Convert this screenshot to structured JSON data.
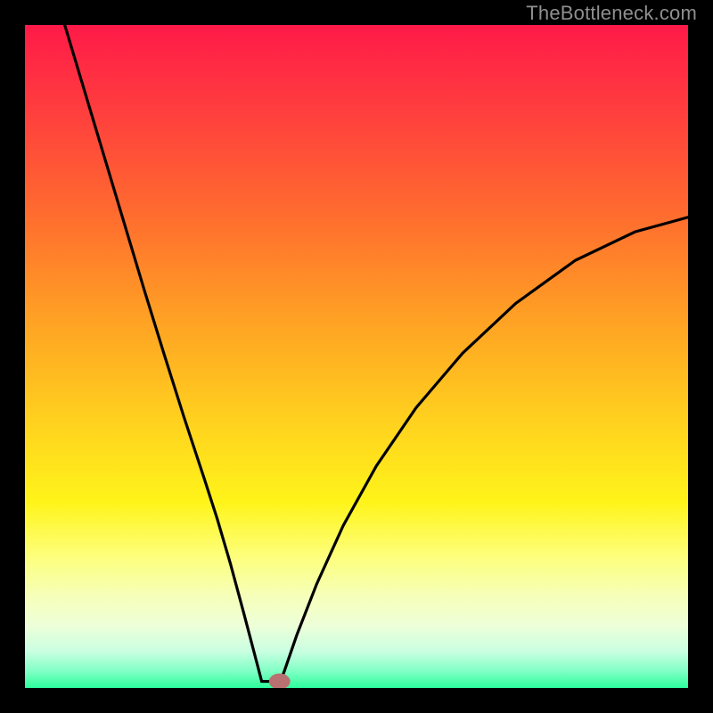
{
  "meta": {
    "watermark": "TheBottleneck.com"
  },
  "chart_data": {
    "type": "line",
    "title": "",
    "xlabel": "",
    "ylabel": "",
    "xlim": [
      0,
      100
    ],
    "ylim": [
      0,
      100
    ],
    "minimum_x": 37,
    "notch_width": 3,
    "curve_top_left_y": 100,
    "curve_top_left_x": 6,
    "curve_right_end_y": 71,
    "marker": {
      "x": 38.4,
      "y": 1.0,
      "rx": 1.6,
      "ry": 1.2,
      "color": "#b87070"
    },
    "gradient_stops": [
      {
        "offset": 0.0,
        "color": "#ff1a48"
      },
      {
        "offset": 0.12,
        "color": "#ff3b3f"
      },
      {
        "offset": 0.28,
        "color": "#ff6a2f"
      },
      {
        "offset": 0.44,
        "color": "#ffa024"
      },
      {
        "offset": 0.6,
        "color": "#ffd21e"
      },
      {
        "offset": 0.72,
        "color": "#fff41a"
      },
      {
        "offset": 0.8,
        "color": "#fdff7a"
      },
      {
        "offset": 0.86,
        "color": "#f6ffb8"
      },
      {
        "offset": 0.905,
        "color": "#eeffd8"
      },
      {
        "offset": 0.945,
        "color": "#c9ffe2"
      },
      {
        "offset": 0.975,
        "color": "#7fffc4"
      },
      {
        "offset": 1.0,
        "color": "#2bff9a"
      }
    ],
    "curve_points": [
      {
        "x": 6.0,
        "y": 100.0
      },
      {
        "x": 9.0,
        "y": 90.0
      },
      {
        "x": 12.0,
        "y": 80.0
      },
      {
        "x": 15.0,
        "y": 70.0
      },
      {
        "x": 18.0,
        "y": 60.0
      },
      {
        "x": 21.0,
        "y": 50.3
      },
      {
        "x": 24.0,
        "y": 40.8
      },
      {
        "x": 27.0,
        "y": 31.7
      },
      {
        "x": 29.0,
        "y": 25.5
      },
      {
        "x": 31.0,
        "y": 18.7
      },
      {
        "x": 33.0,
        "y": 11.3
      },
      {
        "x": 34.0,
        "y": 7.5
      },
      {
        "x": 35.0,
        "y": 3.7
      },
      {
        "x": 35.7,
        "y": 1.0
      },
      {
        "x": 37.0,
        "y": 1.0
      },
      {
        "x": 38.5,
        "y": 1.0
      },
      {
        "x": 39.1,
        "y": 2.5
      },
      {
        "x": 41.0,
        "y": 8.0
      },
      {
        "x": 44.0,
        "y": 15.7
      },
      {
        "x": 48.0,
        "y": 24.5
      },
      {
        "x": 53.0,
        "y": 33.5
      },
      {
        "x": 59.0,
        "y": 42.3
      },
      {
        "x": 66.0,
        "y": 50.5
      },
      {
        "x": 74.0,
        "y": 58.0
      },
      {
        "x": 83.0,
        "y": 64.5
      },
      {
        "x": 92.0,
        "y": 68.8
      },
      {
        "x": 100.0,
        "y": 71.0
      }
    ]
  }
}
